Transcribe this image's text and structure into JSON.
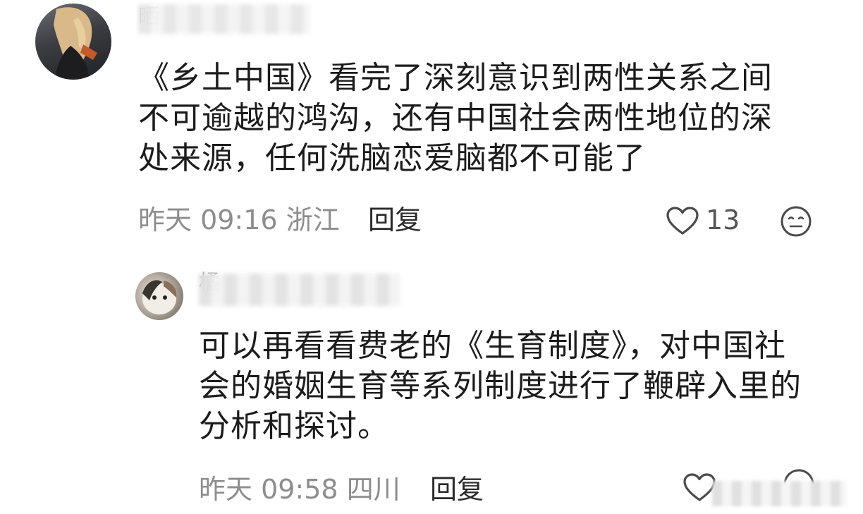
{
  "comment": {
    "username": "晒",
    "text": "《乡土中国》看完了深刻意识到两性关系之间\n不可逾越的鸿沟，还有中国社会两性地位的深\n处来源，任何洗脑恋爱脑都不可能了",
    "time": "昨天 09:16",
    "location": "浙江",
    "reply_label": "回复",
    "likes": "13",
    "icons": {
      "like": "heart-outline-icon",
      "emoji": "emoji-face-icon"
    }
  },
  "reply": {
    "username": "橘",
    "text": "可以再看看费老的《生育制度》，对中国社\n会的婚姻生育等系列制度进行了鞭辟入里的\n分析和探讨。",
    "time": "昨天 09:58",
    "location": "四川",
    "reply_label": "回复",
    "icons": {
      "like": "heart-outline-icon",
      "emoji": "emoji-face-icon"
    }
  },
  "colors": {
    "text": "#1c1c1c",
    "meta": "#8d8d8d",
    "background": "#ffffff"
  }
}
